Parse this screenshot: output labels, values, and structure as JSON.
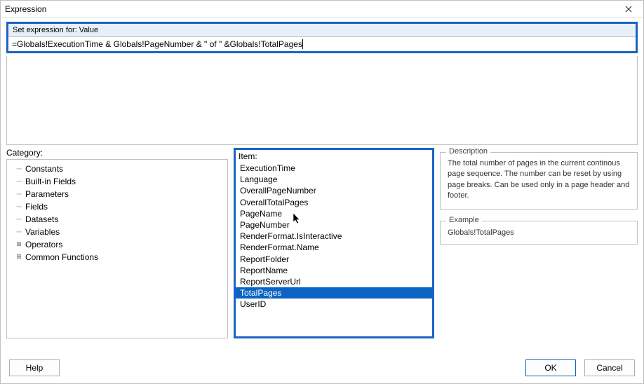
{
  "window": {
    "title": "Expression"
  },
  "expression": {
    "header": "Set expression for: Value",
    "value": "=Globals!ExecutionTime & Globals!PageNumber & \" of \" &Globals!TotalPages"
  },
  "labels": {
    "category": "Category:",
    "item": "Item:",
    "description": "Description",
    "example": "Example"
  },
  "category": {
    "nodes": [
      {
        "label": "Constants",
        "expand": "dash"
      },
      {
        "label": "Built-in Fields",
        "expand": "dash",
        "selected": true
      },
      {
        "label": "Parameters",
        "expand": "dash"
      },
      {
        "label": "Fields",
        "expand": "dash"
      },
      {
        "label": "Datasets",
        "expand": "dash"
      },
      {
        "label": "Variables",
        "expand": "dash"
      },
      {
        "label": "Operators",
        "expand": "plus"
      },
      {
        "label": "Common Functions",
        "expand": "plus"
      }
    ]
  },
  "items": {
    "list": [
      "ExecutionTime",
      "Language",
      "OverallPageNumber",
      "OverallTotalPages",
      "PageName",
      "PageNumber",
      "RenderFormat.IsInteractive",
      "RenderFormat.Name",
      "ReportFolder",
      "ReportName",
      "ReportServerUrl",
      "TotalPages",
      "UserID"
    ],
    "selectedIndex": 11
  },
  "description": "The total number of pages in the current continous page sequence. The number can be reset by using page breaks. Can be used only in a page header and footer.",
  "example": "Globals!TotalPages",
  "buttons": {
    "help": "Help",
    "ok": "OK",
    "cancel": "Cancel"
  }
}
